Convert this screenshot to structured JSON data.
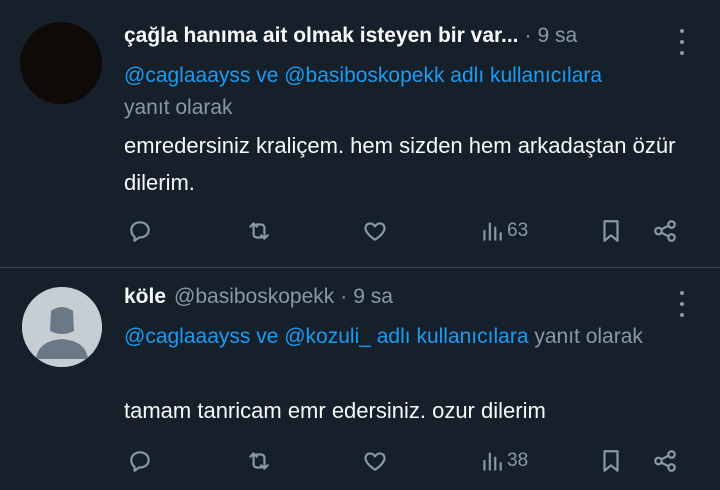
{
  "tweets": [
    {
      "author_name": "çağla hanıma ait olmak isteyen bir var...",
      "handle": "",
      "separator": "·",
      "time": "9 sa",
      "reply_mentions": "@caglaaayss ve @basiboskopekk adlı kullanıcılara",
      "reply_suffix": "yanıt olarak",
      "text": "emredersiniz kraliçem. hem sizden hem arkadaştan özür dilerim.",
      "views": "63",
      "avatar": "dark-photo"
    },
    {
      "author_name": "köle",
      "handle": "@basiboskopekk",
      "separator": "·",
      "time": "9 sa",
      "reply_mentions": "@caglaaayss ve @kozuli_ adlı kullanıcılara",
      "reply_suffix": "yanıt olarak",
      "text": "tamam tanricam emr edersiniz. ozur dilerim",
      "views": "38",
      "avatar": "default-person-icon"
    }
  ],
  "icons": [
    "reply-icon",
    "retweet-icon",
    "like-icon",
    "views-icon",
    "bookmark-icon",
    "share-icon",
    "more-icon"
  ],
  "colors": {
    "background": "#15202b",
    "text": "#f7f9f9",
    "secondary": "#8b98a5",
    "link": "#1d9bf0",
    "divider": "#38444d"
  }
}
